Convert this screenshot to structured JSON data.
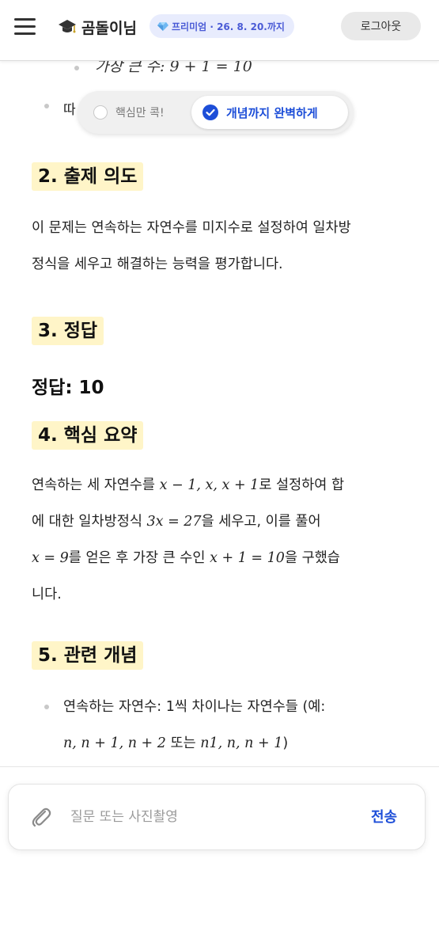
{
  "header": {
    "brand_name": "곰돌이님",
    "premium_badge": "프리미엄 · 26. 8. 20.까지",
    "logout_label": "로그아웃"
  },
  "toggle": {
    "option_core": "핵심만 콕!",
    "option_full": "개념까지 완벽하게",
    "selected": "option_full"
  },
  "content": {
    "cut_line_text": "가장 큰 수: 9 + 1 = 10",
    "partial_bullet_text": "따",
    "sections": [
      {
        "title": "2. 출제 의도",
        "body": [
          "이 문제는 연속하는 자연수를 미지수로 설정하여 일차방",
          "정식을 세우고 해결하는 능력을 평가합니다."
        ]
      },
      {
        "title": "3. 정답",
        "answer": "정답: 10"
      },
      {
        "title": "4. 핵심 요약"
      },
      {
        "title": "5. 관련 개념"
      }
    ],
    "summary": {
      "t1": "연속하는 세 자연수를 ",
      "m1": "x − 1, x, x + 1",
      "t2": "로 설정하여 합",
      "t3": "에 대한 일차방정식 ",
      "m2": "3x = 27",
      "t4": "을 세우고, 이를 풀어",
      "m3": "x = 9",
      "t5": "를 얻은 후 가장 큰 수인 ",
      "m4": "x + 1 = 10",
      "t6": "을 구했습",
      "t7": "니다."
    },
    "concept": {
      "t1": "연속하는 자연수: 1씩 차이나는 자연수들 (예:",
      "m1": "n, n + 1, n + 2",
      "t2": " 또는 ",
      "m2": "n1, n, n + 1",
      "t3": ")"
    }
  },
  "input": {
    "placeholder": "질문 또는 사진촬영",
    "send_label": "전송"
  },
  "colors": {
    "accent": "#1d4ed8",
    "highlight": "#fff5c8",
    "badge_bg": "#e8ecfd"
  }
}
